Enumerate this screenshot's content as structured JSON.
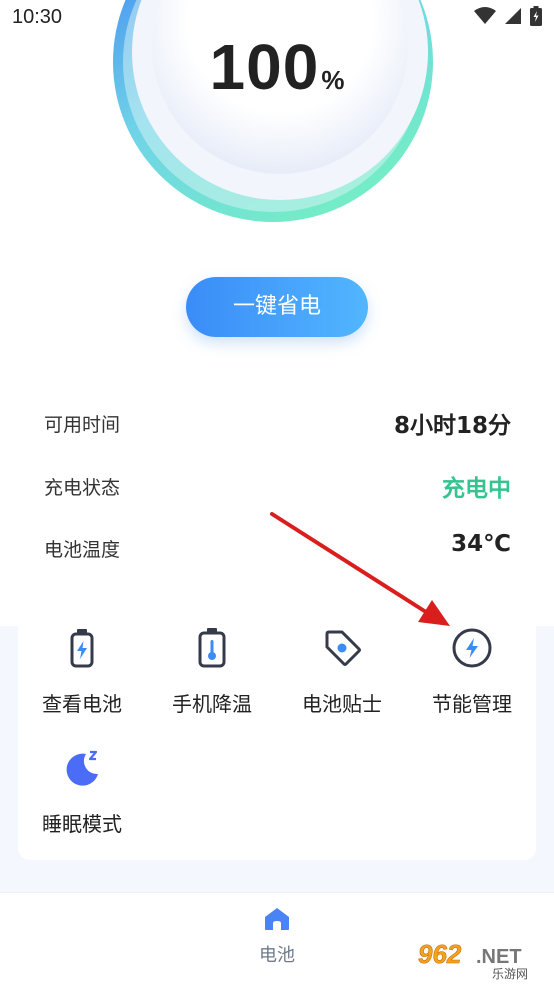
{
  "status_bar": {
    "time": "10:30"
  },
  "gauge": {
    "value": "100",
    "unit": "%"
  },
  "action": {
    "save_label": "一键省电"
  },
  "info": [
    {
      "label": "可用时间",
      "value": "8小时18分"
    },
    {
      "label": "充电状态",
      "value": "充电中"
    },
    {
      "label": "电池温度",
      "value": "34℃"
    }
  ],
  "features": [
    {
      "label": "查看电池",
      "icon": "battery-icon"
    },
    {
      "label": "手机降温",
      "icon": "thermometer-icon"
    },
    {
      "label": "电池贴士",
      "icon": "tag-icon"
    },
    {
      "label": "节能管理",
      "icon": "lightning-circle-icon"
    },
    {
      "label": "睡眠模式",
      "icon": "moon-sleep-icon"
    }
  ],
  "tabbar": {
    "battery_label": "电池"
  },
  "watermark": {
    "text": "962.NET",
    "subtext": "乐游网"
  },
  "colors": {
    "accent_blue": "#3a8cf7",
    "status_green": "#33c48f",
    "arrow_red": "#d91e1e"
  }
}
